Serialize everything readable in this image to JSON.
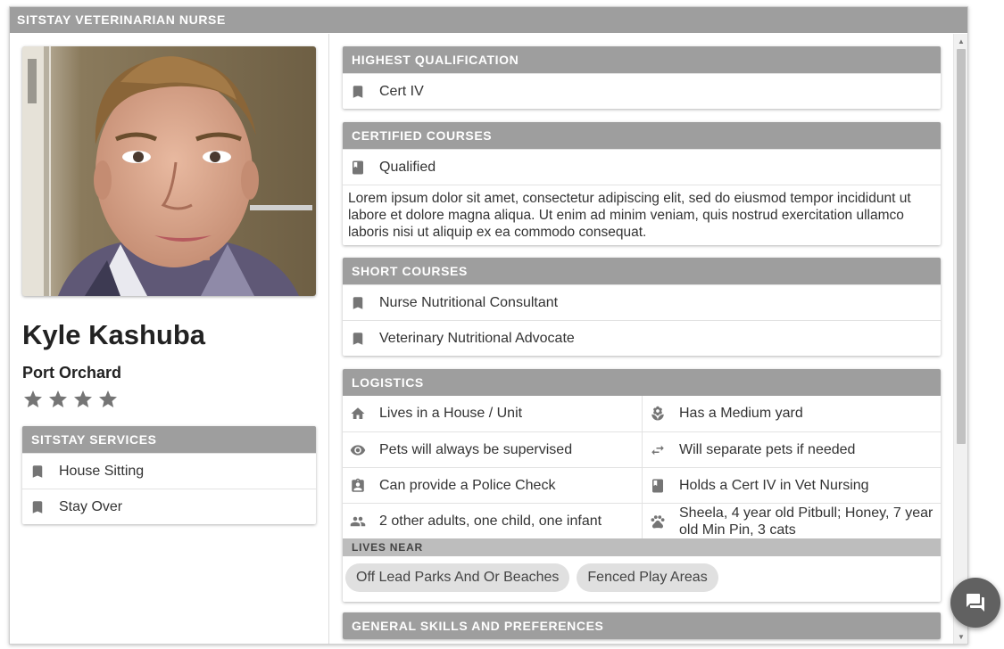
{
  "window": {
    "title": "SITSTAY VETERINARIAN NURSE"
  },
  "profile": {
    "name": "Kyle Kashuba",
    "location": "Port Orchard",
    "rating": 4,
    "rating_max": 4
  },
  "services": {
    "header": "SITSTAY SERVICES",
    "items": [
      {
        "icon": "bookmark-icon",
        "label": "House Sitting"
      },
      {
        "icon": "bookmark-icon",
        "label": "Stay Over"
      }
    ]
  },
  "highest_qualification": {
    "header": "HIGHEST QUALIFICATION",
    "items": [
      {
        "icon": "bookmark-icon",
        "label": "Cert IV"
      }
    ]
  },
  "certified_courses": {
    "header": "CERTIFIED COURSES",
    "items": [
      {
        "icon": "book-icon",
        "label": "Qualified"
      }
    ],
    "description": "Lorem ipsum dolor sit amet, consectetur adipiscing elit, sed do eiusmod tempor incididunt ut labore et dolore magna aliqua. Ut enim ad minim veniam, quis nostrud exercitation ullamco laboris nisi ut aliquip ex ea commodo consequat."
  },
  "short_courses": {
    "header": "SHORT COURSES",
    "items": [
      {
        "icon": "bookmark-icon",
        "label": "Nurse Nutritional Consultant"
      },
      {
        "icon": "bookmark-icon",
        "label": "Veterinary Nutritional Advocate"
      }
    ]
  },
  "logistics": {
    "header": "LOGISTICS",
    "items": [
      {
        "icon": "home-icon",
        "label": "Lives in a House / Unit"
      },
      {
        "icon": "flower-icon",
        "label": "Has a Medium yard"
      },
      {
        "icon": "eye-icon",
        "label": "Pets will always be supervised"
      },
      {
        "icon": "swap-arrows-icon",
        "label": "Will separate pets if needed"
      },
      {
        "icon": "id-badge-icon",
        "label": "Can provide a Police Check"
      },
      {
        "icon": "book-icon",
        "label": "Holds a Cert IV in Vet Nursing"
      },
      {
        "icon": "people-icon",
        "label": "2 other adults, one child, one infant"
      },
      {
        "icon": "paw-icon",
        "label": "Sheela, 4 year old Pitbull; Honey, 7 year old Min Pin, 3 cats"
      }
    ],
    "lives_near": {
      "header": "LIVES NEAR",
      "chips": [
        "Off Lead Parks And Or Beaches",
        "Fenced Play Areas"
      ]
    }
  },
  "general_skills": {
    "header": "GENERAL SKILLS AND PREFERENCES"
  },
  "colors": {
    "header": "#9e9e9e",
    "subheader": "#bdbdbd",
    "icon": "#757575",
    "chip": "#e0e0e0",
    "fab": "#616161"
  }
}
